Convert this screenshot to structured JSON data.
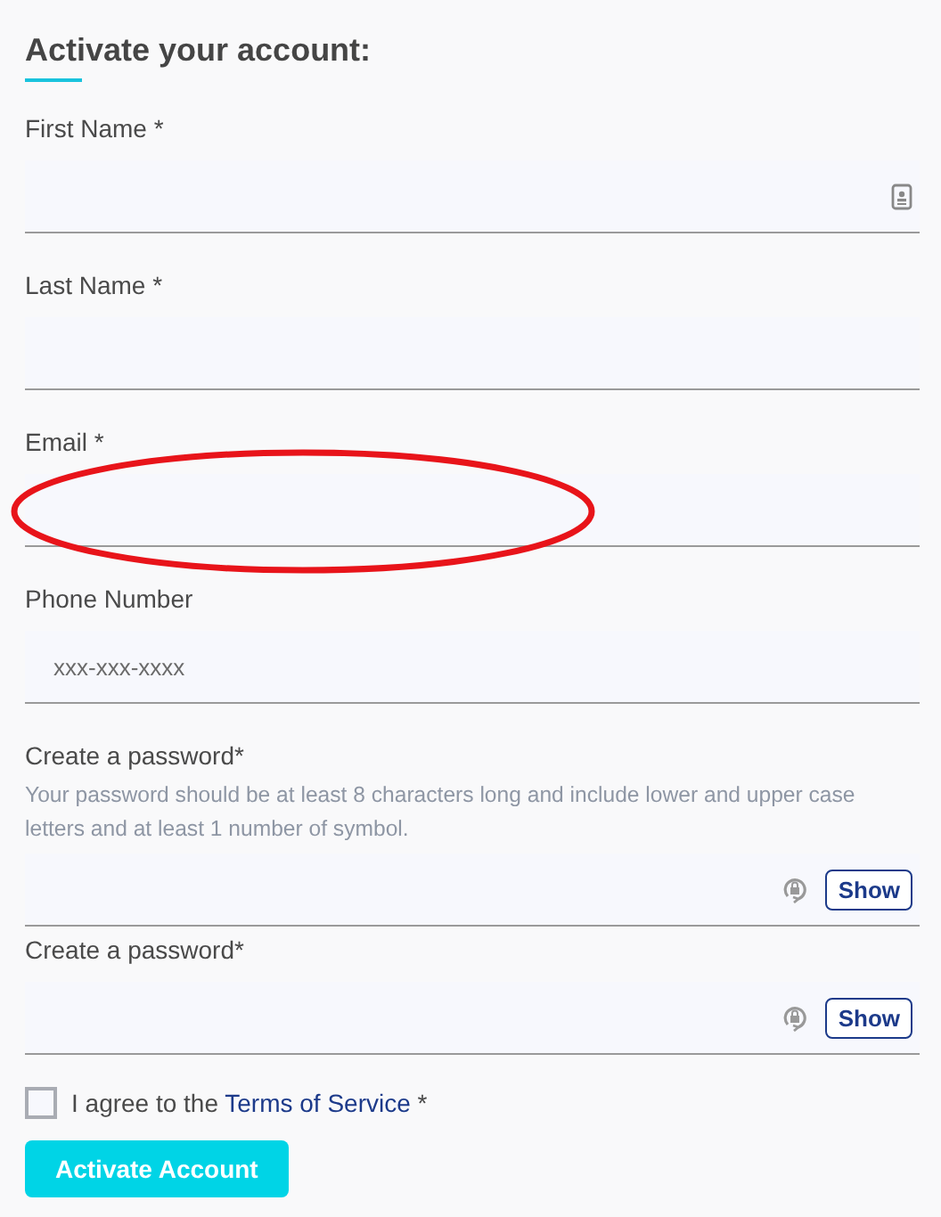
{
  "heading": "Activate your account:",
  "fields": [
    {
      "kind": "contact",
      "label": "First Name *",
      "circled": false
    },
    {
      "kind": "text",
      "label": "Last Name *",
      "circled": false
    },
    {
      "kind": "text",
      "label": "Email *",
      "circled": true
    },
    {
      "kind": "text",
      "label": "Phone Number",
      "placeholder": "xxx-xxx-xxxx",
      "circled": false
    },
    {
      "kind": "password",
      "label": "Create a password*",
      "hint": "Your password should be at least 8 characters long and include lower and upper case letters and at least 1 number of symbol.",
      "button": "Show",
      "circled": false
    },
    {
      "kind": "password",
      "label": "Create a password*",
      "button": "Show",
      "circled": false
    }
  ],
  "agreement": {
    "checked": false,
    "before": "I agree to the ",
    "link": "Terms of Service",
    "after": " *"
  },
  "submit": "Activate Account"
}
